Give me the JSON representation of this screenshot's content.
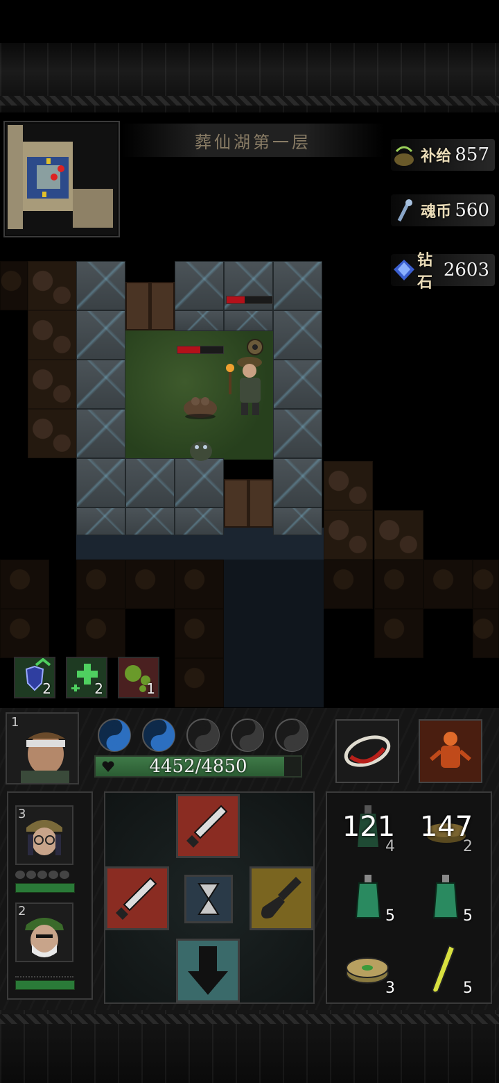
{
  "level": {
    "name": "葬仙湖第一层"
  },
  "resources": [
    {
      "id": "supply",
      "label": "补给",
      "value": "857",
      "icon": "supply-pot-icon"
    },
    {
      "id": "soul",
      "label": "魂币",
      "value": "560",
      "icon": "soul-coin-icon"
    },
    {
      "id": "diamond",
      "label": "钻石",
      "value": "2603",
      "icon": "diamond-icon"
    }
  ],
  "buffs": [
    {
      "name": "shield-buff",
      "count": "2",
      "icon": "shield-up-icon"
    },
    {
      "name": "heal-buff",
      "count": "2",
      "icon": "heal-plus-icon"
    },
    {
      "name": "poison-buff",
      "count": "1",
      "icon": "poison-blob-icon"
    }
  ],
  "hero": {
    "slot": "1",
    "hp_text": "4452/4850",
    "hp_fraction": 0.918,
    "energy_total": 5,
    "energy_filled": 2
  },
  "party": [
    {
      "slot": "3",
      "name": "party-member-goggles"
    },
    {
      "slot": "2",
      "name": "party-member-soldier"
    }
  ],
  "items": [
    {
      "name": "potion-stack",
      "big": "121",
      "count": "4",
      "icon": "potion-icon"
    },
    {
      "name": "coin-stack",
      "big": "147",
      "count": "2",
      "icon": "coins-icon"
    },
    {
      "name": "green-potion-a",
      "big": "",
      "count": "5",
      "icon": "green-potion-icon"
    },
    {
      "name": "green-potion-b",
      "big": "",
      "count": "5",
      "icon": "green-potion-icon"
    },
    {
      "name": "jade-coins",
      "big": "",
      "count": "3",
      "icon": "jade-coins-icon"
    },
    {
      "name": "elixir-vial",
      "big": "",
      "count": "5",
      "icon": "elixir-vial-icon"
    }
  ],
  "actions": [
    {
      "name": "attack-up",
      "icon": "dagger-icon",
      "color": "#8a2c22"
    },
    {
      "name": "attack-left",
      "icon": "dagger-icon",
      "color": "#8a2c22"
    },
    {
      "name": "wait",
      "icon": "hourglass-icon",
      "color": "#2a3a48"
    },
    {
      "name": "dig-right",
      "icon": "shovel-icon",
      "color": "#7a6520"
    },
    {
      "name": "descend",
      "icon": "down-arrow-icon",
      "color": "#3a6a6a"
    }
  ],
  "enemies": [
    {
      "name": "enemy-top",
      "hp_fraction": 0.4
    },
    {
      "name": "enemy-left",
      "hp_fraction": 0.5
    }
  ]
}
